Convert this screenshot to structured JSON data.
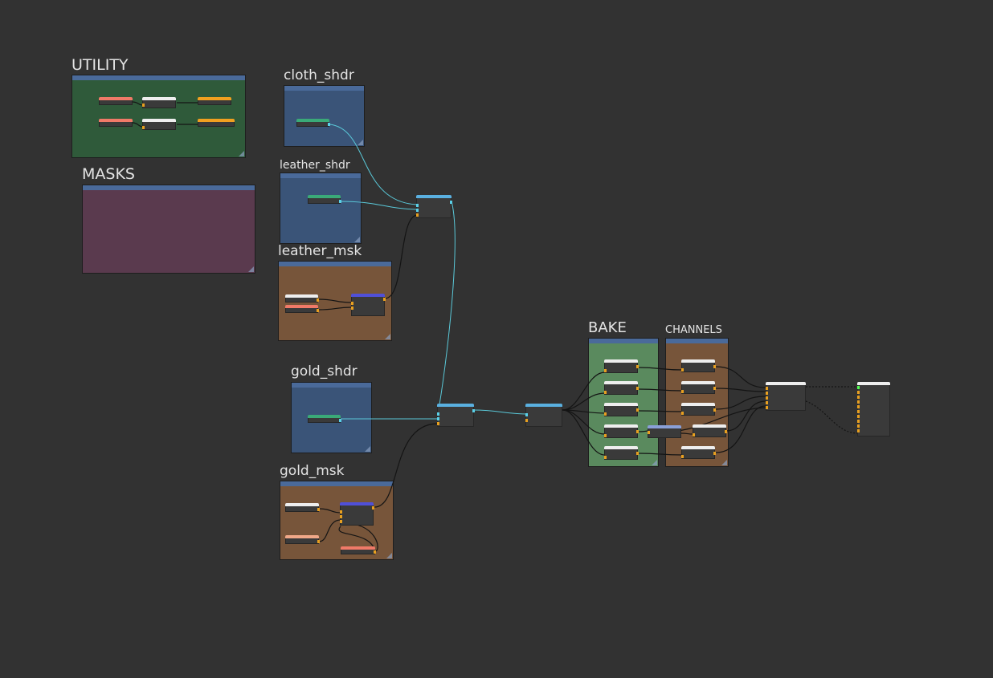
{
  "frames": {
    "utility": {
      "label": "UTILITY",
      "bg": "#2f5a3a"
    },
    "masks": {
      "label": "MASKS",
      "bg": "#5a3a4e"
    },
    "cloth_shdr": {
      "label": "cloth_shdr",
      "bg": "#3a5478"
    },
    "leather_shdr": {
      "label": "leather_shdr",
      "bg": "#3a5478"
    },
    "leather_msk": {
      "label": "leather_msk",
      "bg": "#77553a"
    },
    "gold_shdr": {
      "label": "gold_shdr",
      "bg": "#3a5478"
    },
    "gold_msk": {
      "label": "gold_msk",
      "bg": "#77553a"
    },
    "bake": {
      "label": "BAKE",
      "bg": "#5a8a5e"
    },
    "channels": {
      "label": "CHANNELS",
      "bg": "#77553a"
    }
  },
  "colors": {
    "canvas": "#323232",
    "frame_bar": "#4a6a9a",
    "node_body": "#3a3a3a",
    "header_salmon": "#f07a68",
    "header_white": "#eeeeee",
    "header_orange": "#f0a020",
    "header_green": "#3aaa78",
    "header_blue": "#5050d8",
    "header_cyan": "#5ab0e0",
    "header_lavender": "#8aa0d8",
    "header_peach": "#f0a888",
    "port_orange": "#e8a020",
    "port_cyan": "#5ad0e8",
    "wire_dark": "#141414",
    "wire_cyan": "#5ac8d8"
  },
  "icons": [
    "frame-resize-handle-icon"
  ]
}
